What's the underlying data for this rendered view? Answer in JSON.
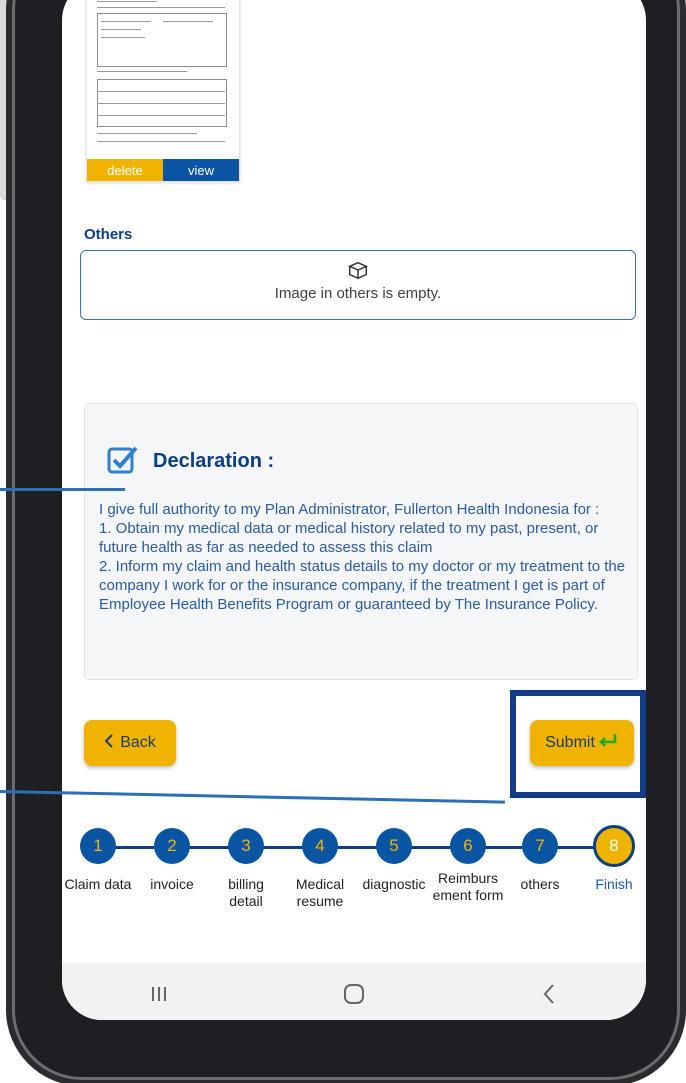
{
  "thumbnail": {
    "delete_label": "delete",
    "view_label": "view"
  },
  "others": {
    "title": "Others",
    "empty_text": "Image in others is empty."
  },
  "declaration": {
    "title": "Declaration :",
    "checked": true,
    "body": "I give full authority to my Plan Administrator, Fullerton Health Indonesia for :\n 1. Obtain my medical data or medical history related to my past, present, or future health as far as needed to assess this claim\n 2. Inform my claim and health status details to my doctor or my treatment to the company I work for or the insurance company, if the treatment I get is part of Employee Health Benefits Program or guaranteed by The Insurance Policy."
  },
  "buttons": {
    "back": "Back",
    "submit": "Submit"
  },
  "steps": [
    {
      "number": "1",
      "label": "Claim data"
    },
    {
      "number": "2",
      "label": "invoice"
    },
    {
      "number": "3",
      "label": "billing detail"
    },
    {
      "number": "4",
      "label": "Medical resume"
    },
    {
      "number": "5",
      "label": "diagnostic"
    },
    {
      "number": "6",
      "label": "Reimburs ement form"
    },
    {
      "number": "7",
      "label": "others"
    },
    {
      "number": "8",
      "label": "Finish"
    }
  ],
  "current_step": 8,
  "colors": {
    "accent_yellow": "#f0b400",
    "primary_blue": "#0a54a4",
    "dark_blue": "#0a3f86"
  },
  "nav": {
    "icons": [
      "recent-apps-icon",
      "home-icon",
      "back-nav-icon"
    ]
  }
}
